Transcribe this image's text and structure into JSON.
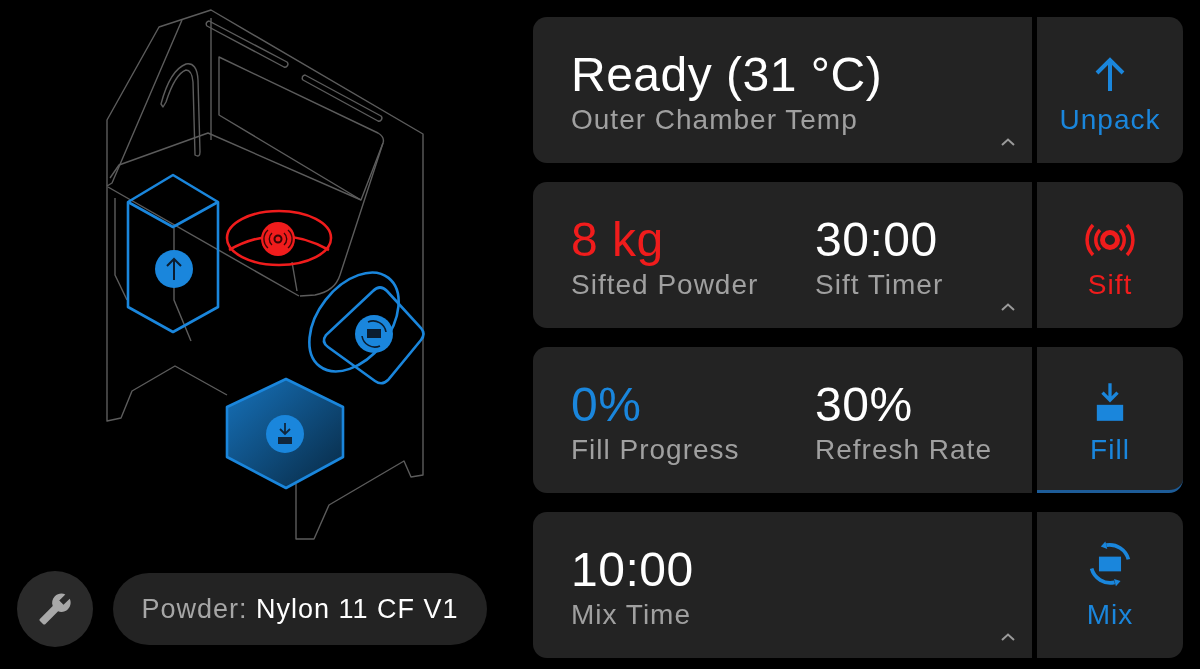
{
  "rows": [
    {
      "metrics": [
        {
          "value": "Ready (31 °C)",
          "label": "Outer Chamber Temp",
          "color": "#ffffff"
        }
      ],
      "expandable": true,
      "action": {
        "kind": "unpack",
        "label": "Unpack",
        "color": "#1a86dc",
        "selected": false
      }
    },
    {
      "metrics": [
        {
          "value": "8 kg",
          "label": "Sifted Powder",
          "color": "#f01c1c"
        },
        {
          "value": "30:00",
          "label": "Sift Timer",
          "color": "#ffffff"
        }
      ],
      "expandable": true,
      "action": {
        "kind": "sift",
        "label": "Sift",
        "color": "#f01c1c",
        "selected": false
      }
    },
    {
      "metrics": [
        {
          "value": "0%",
          "label": "Fill Progress",
          "color": "#1a86dc"
        },
        {
          "value": "30%",
          "label": "Refresh Rate",
          "color": "#ffffff"
        }
      ],
      "expandable": false,
      "action": {
        "kind": "fill",
        "label": "Fill",
        "color": "#1a86dc",
        "selected": true
      }
    },
    {
      "metrics": [
        {
          "value": "10:00",
          "label": "Mix Time",
          "color": "#ffffff"
        }
      ],
      "expandable": true,
      "action": {
        "kind": "mix",
        "label": "Mix",
        "color": "#1a86dc",
        "selected": false
      }
    }
  ],
  "powder": {
    "label": "Powder:",
    "value": "Nylon 11 CF V1"
  }
}
